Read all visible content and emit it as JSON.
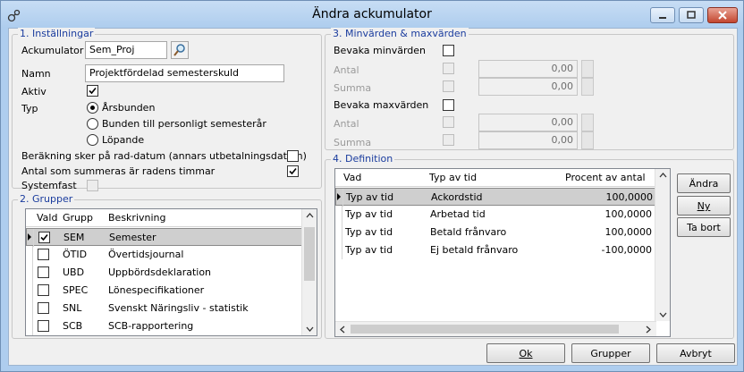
{
  "window": {
    "title": "Ändra ackumulator",
    "minimize_icon": "minimize-icon",
    "maximize_icon": "maximize-icon",
    "close_icon": "close-icon"
  },
  "installningar": {
    "legend": "1. Inställningar",
    "ackumulator_label": "Ackumulator",
    "ackumulator_value": "Sem_Proj",
    "namn_label": "Namn",
    "namn_value": "Projektfördelad semesterskuld",
    "aktiv_label": "Aktiv",
    "aktiv_checked": true,
    "typ_label": "Typ",
    "typ_options": [
      {
        "label": "Årsbunden",
        "selected": true
      },
      {
        "label": "Bunden till personligt semesterår",
        "selected": false
      },
      {
        "label": "Löpande",
        "selected": false
      }
    ],
    "berakning_label": "Beräkning sker på rad-datum (annars utbetalningsdatum)",
    "berakning_checked": false,
    "antal_label": "Antal som summeras är radens timmar",
    "antal_checked": true,
    "systemfast_label": "Systemfast",
    "systemfast_checked": false
  },
  "minvarden": {
    "legend": "3. Minvärden  & maxvärden",
    "bevaka_min_label": "Bevaka minvärden",
    "antal_label": "Antal",
    "antal_min_value": "0,00",
    "summa_label": "Summa",
    "summa_min_value": "0,00",
    "bevaka_max_label": "Bevaka maxvärden",
    "antal_max_value": "0,00",
    "summa_max_value": "0,00"
  },
  "grupper": {
    "legend": "2. Grupper",
    "columns": [
      "Vald",
      "Grupp",
      "Beskrivning"
    ],
    "rows": [
      {
        "vald": true,
        "grupp": "SEM",
        "beskrivning": "Semester",
        "selected": true
      },
      {
        "vald": false,
        "grupp": "ÖTID",
        "beskrivning": "Övertidsjournal",
        "selected": false
      },
      {
        "vald": false,
        "grupp": "UBD",
        "beskrivning": "Uppbördsdeklaration",
        "selected": false
      },
      {
        "vald": false,
        "grupp": "SPEC",
        "beskrivning": "Lönespecifikationer",
        "selected": false
      },
      {
        "vald": false,
        "grupp": "SNL",
        "beskrivning": "Svenskt Näringsliv - statistik",
        "selected": false
      },
      {
        "vald": false,
        "grupp": "SCB",
        "beskrivning": "SCB-rapportering",
        "selected": false
      }
    ]
  },
  "definition": {
    "legend": "4. Definition",
    "columns": [
      "Vad",
      "Typ av tid",
      "Procent av antal"
    ],
    "rows": [
      {
        "vad": "Typ av tid",
        "typ": "Ackordstid",
        "procent": "100,0000",
        "selected": true
      },
      {
        "vad": "Typ av tid",
        "typ": "Arbetad tid",
        "procent": "100,0000",
        "selected": false
      },
      {
        "vad": "Typ av tid",
        "typ": "Betald frånvaro",
        "procent": "100,0000",
        "selected": false
      },
      {
        "vad": "Typ av tid",
        "typ": "Ej betald frånvaro",
        "procent": "-100,0000",
        "selected": false
      }
    ],
    "andra_button": "Ändra",
    "ny_button": "Ny",
    "tabort_button": "Ta bort"
  },
  "footer": {
    "ok_button": "Ok",
    "grupper_button": "Grupper",
    "avbryt_button": "Avbryt"
  }
}
